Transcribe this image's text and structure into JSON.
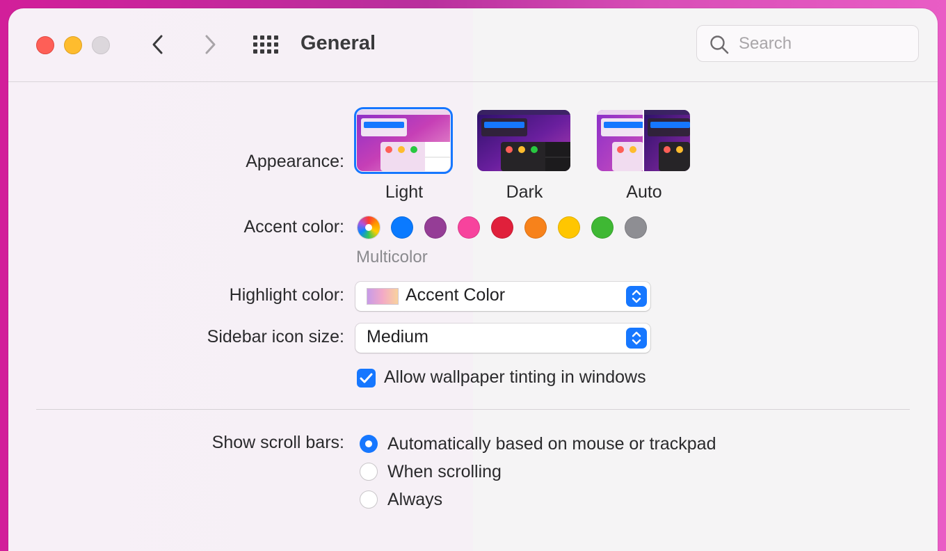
{
  "window": {
    "title": "General"
  },
  "search": {
    "placeholder": "Search"
  },
  "appearance": {
    "label": "Appearance:",
    "options": [
      {
        "name": "Light",
        "selected": true
      },
      {
        "name": "Dark",
        "selected": false
      },
      {
        "name": "Auto",
        "selected": false
      }
    ]
  },
  "accent": {
    "label": "Accent color:",
    "selected_caption": "Multicolor",
    "colors": [
      "multicolor",
      "#0a7aff",
      "#953d96",
      "#f7439d",
      "#e0203b",
      "#f7821b",
      "#ffc600",
      "#3fb834",
      "#8e8e93"
    ]
  },
  "highlight": {
    "label": "Highlight color:",
    "value": "Accent Color"
  },
  "sidebar_size": {
    "label": "Sidebar icon size:",
    "value": "Medium"
  },
  "tinting": {
    "label": "Allow wallpaper tinting in windows",
    "checked": true
  },
  "scroll_bars": {
    "label": "Show scroll bars:",
    "options": [
      {
        "label": "Automatically based on mouse or trackpad",
        "selected": true
      },
      {
        "label": "When scrolling",
        "selected": false
      },
      {
        "label": "Always",
        "selected": false
      }
    ]
  },
  "colors": {
    "accent_blue": "#1677ff",
    "close": "#fe5f57",
    "minimize": "#febc2e",
    "zoom_disabled": "#dcd7dc"
  },
  "icons": [
    "close-icon",
    "minimize-icon",
    "zoom-icon",
    "back-chevron-icon",
    "forward-chevron-icon",
    "grid-icon",
    "search-icon",
    "chevron-updown-icon",
    "checkmark-icon"
  ]
}
